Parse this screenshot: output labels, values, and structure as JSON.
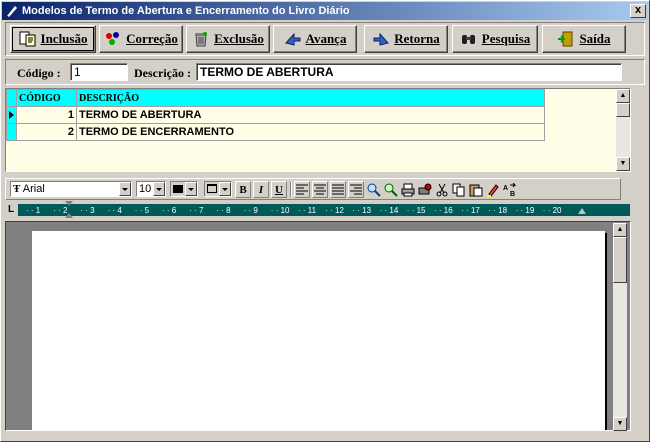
{
  "window": {
    "title": "Modelos de Termo de Abertura e  Encerramento do Livro Diário",
    "close_glyph": "x"
  },
  "toolbar": {
    "buttons": [
      {
        "label": "Inclusão",
        "icon": "add-document-icon"
      },
      {
        "label": "Correção",
        "icon": "edit-icon"
      },
      {
        "label": "Exclusão",
        "icon": "trash-icon"
      },
      {
        "label": "Avança",
        "icon": "arrow-forward-icon"
      },
      {
        "label": "Retorna",
        "icon": "arrow-back-icon"
      },
      {
        "label": "Pesquisa",
        "icon": "binoculars-icon"
      },
      {
        "label": "Saída",
        "icon": "exit-door-icon"
      }
    ]
  },
  "form": {
    "codigo_label": "Código :",
    "codigo_value": "1",
    "descricao_label": "Descrição :",
    "descricao_value": "TERMO DE ABERTURA"
  },
  "grid": {
    "columns": [
      "CÓDIGO",
      "DESCRIÇÃO"
    ],
    "rows": [
      {
        "codigo": "1",
        "descricao": "TERMO DE ABERTURA",
        "selected": true
      },
      {
        "codigo": "2",
        "descricao": "TERMO DE ENCERRAMENTO",
        "selected": false
      }
    ]
  },
  "format_toolbar": {
    "font_name": "Arial",
    "font_glyph": "Ŧ",
    "font_size": "10",
    "bold_label": "B",
    "italic_label": "I",
    "underline_label": "U",
    "font_color": "#000000"
  },
  "ruler": {
    "corner_glyph": "L",
    "ticks": [
      "1",
      "2",
      "3",
      "4",
      "5",
      "6",
      "7",
      "8",
      "9",
      "10",
      "11",
      "12",
      "13",
      "14",
      "15",
      "16",
      "17",
      "18",
      "19",
      "20"
    ]
  },
  "colors": {
    "grid_header": "#00ffff",
    "grid_background": "#ffffe8",
    "ruler_background": "#005a5a",
    "title_start": "#0a246a",
    "title_end": "#a6caf0"
  }
}
